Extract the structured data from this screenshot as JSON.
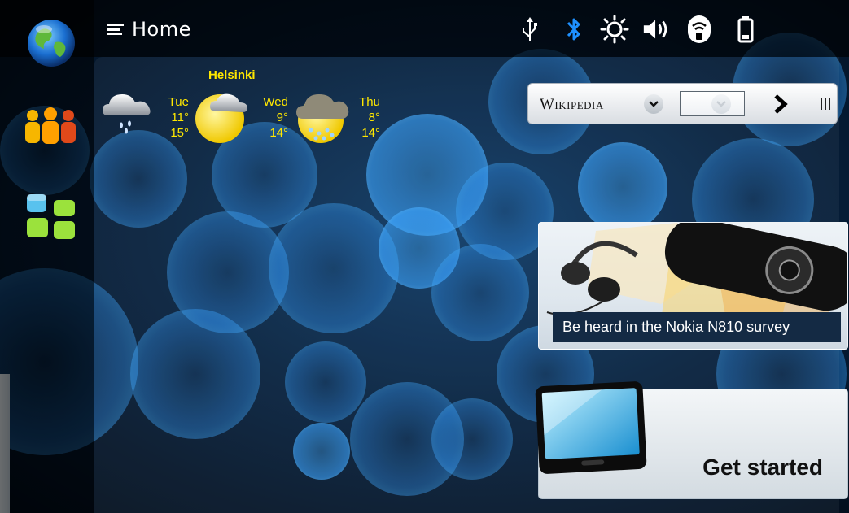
{
  "topbar": {
    "home_label": "Home",
    "status_icons": [
      "usb-icon",
      "bluetooth-icon",
      "brightness-icon",
      "volume-icon",
      "wifi-icon",
      "battery-icon"
    ]
  },
  "sidebar": {
    "items": [
      {
        "name": "web-browser-icon"
      },
      {
        "name": "contacts-icon"
      },
      {
        "name": "applications-icon"
      }
    ]
  },
  "weather": {
    "city": "Helsinki",
    "days": [
      {
        "day": "Tue",
        "high": "11°",
        "low": "15°",
        "icon": "rain-cloud-icon"
      },
      {
        "day": "Wed",
        "high": "9°",
        "low": "14°",
        "icon": "partly-cloudy-icon"
      },
      {
        "day": "Thu",
        "high": "8°",
        "low": "14°",
        "icon": "heavy-rain-icon"
      }
    ]
  },
  "wikipedia": {
    "logo": "Wikipedia"
  },
  "survey": {
    "caption": "Be heard in the Nokia N810 survey"
  },
  "get_started": {
    "label": "Get started"
  },
  "colors": {
    "weather_text": "#ffe800",
    "accent_blue": "#1e90ff"
  }
}
